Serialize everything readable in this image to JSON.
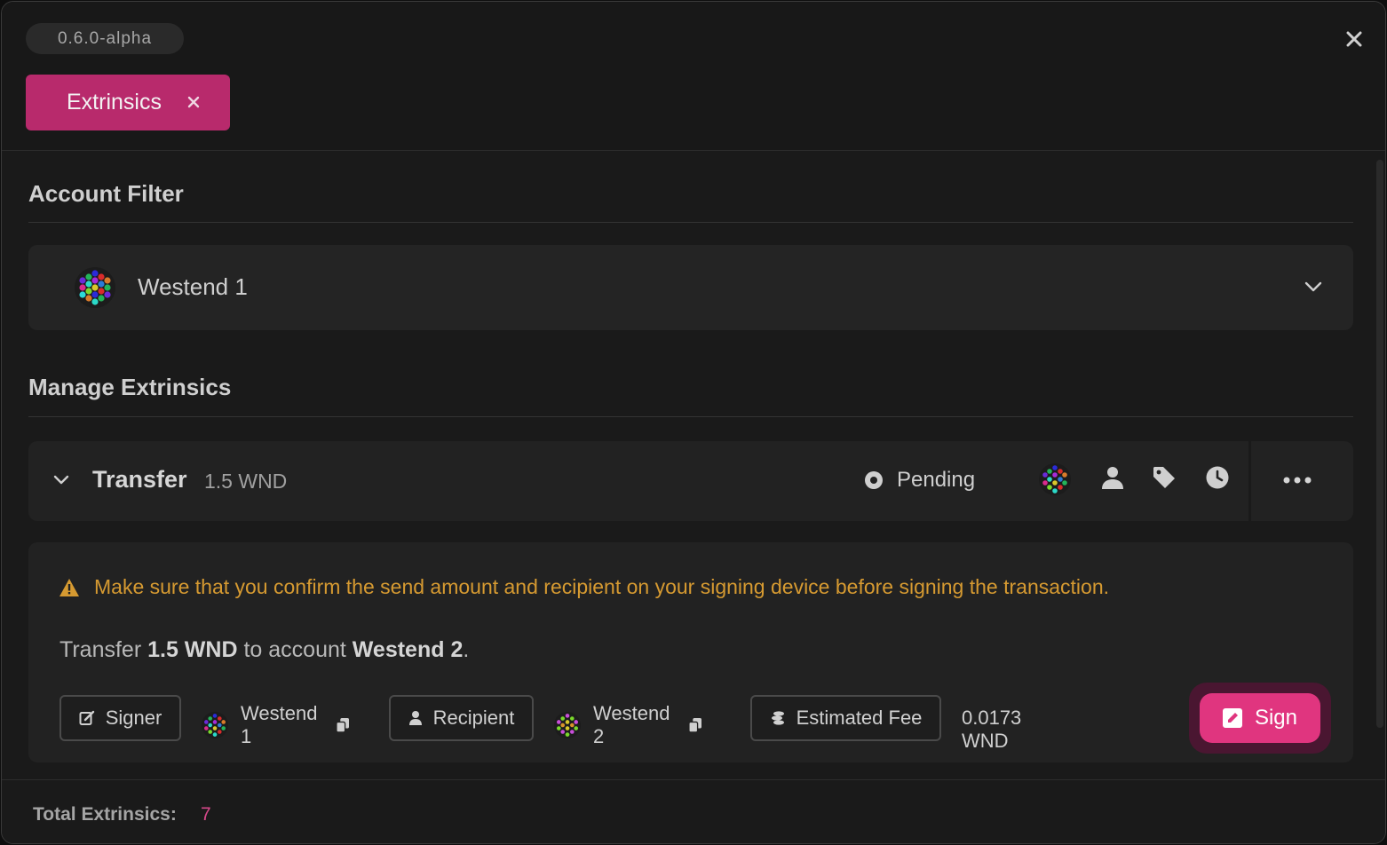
{
  "version": "0.6.0-alpha",
  "tabs": [
    {
      "label": "Extrinsics"
    }
  ],
  "account_filter": {
    "title": "Account Filter",
    "selected_account": "Westend 1"
  },
  "manage": {
    "title": "Manage Extrinsics",
    "extrinsic": {
      "name": "Transfer",
      "amount": "1.5 WND",
      "status": "Pending",
      "warning": "Make sure that you confirm the send amount and recipient on your signing device before signing the transaction.",
      "summary": {
        "prefix": "Transfer",
        "amount": "1.5 WND",
        "middle": "to account",
        "recipient": "Westend 2",
        "suffix": "."
      },
      "signer_label": "Signer",
      "signer_account": "Westend 1",
      "recipient_label": "Recipient",
      "recipient_account": "Westend 2",
      "fee_label": "Estimated Fee",
      "fee_value": "0.0173 WND",
      "sign_label": "Sign"
    }
  },
  "footer": {
    "total_label": "Total Extrinsics:",
    "total_count": "7"
  },
  "colors": {
    "accent": "#e0357f",
    "tab_active": "#b82a6c",
    "warning": "#d69a31"
  }
}
